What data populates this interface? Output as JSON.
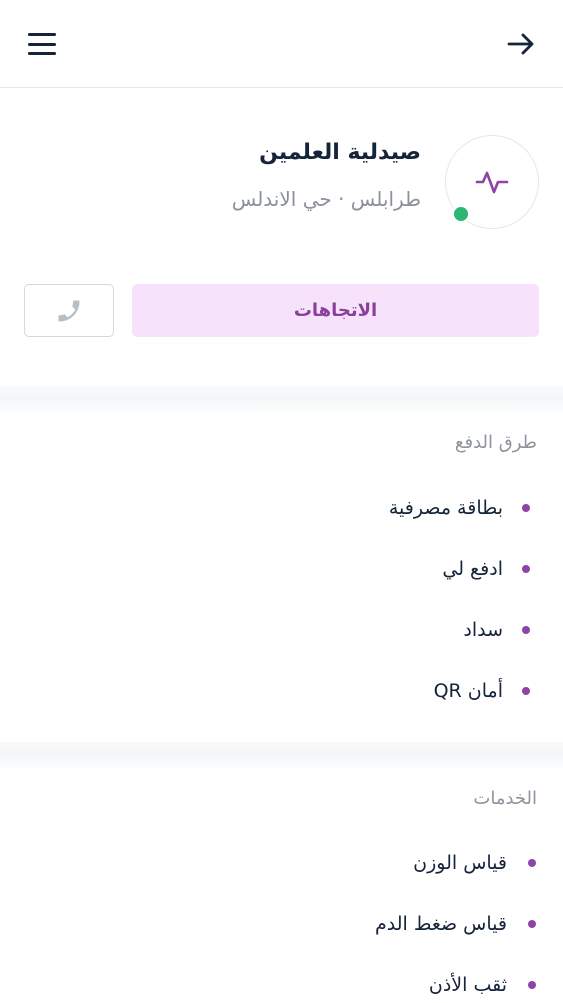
{
  "pharmacy": {
    "name": "صيدلية العلمين",
    "location": "طرابلس · حي الاندلس",
    "status_color": "#2bb673"
  },
  "actions": {
    "directions_label": "الاتجاهات",
    "call_icon": "phone-icon"
  },
  "payment": {
    "title": "طرق الدفع",
    "items": [
      "بطاقة مصرفية",
      "ادفع لي",
      "سداد",
      "أمان QR"
    ]
  },
  "services": {
    "title": "الخدمات",
    "items": [
      "قياس الوزن",
      "قياس ضغط الدم",
      "ثقب الأذن"
    ]
  },
  "colors": {
    "accent": "#8e44a6",
    "accent_bg": "#f6e3fb",
    "text": "#15233b",
    "muted": "#8e949d"
  }
}
